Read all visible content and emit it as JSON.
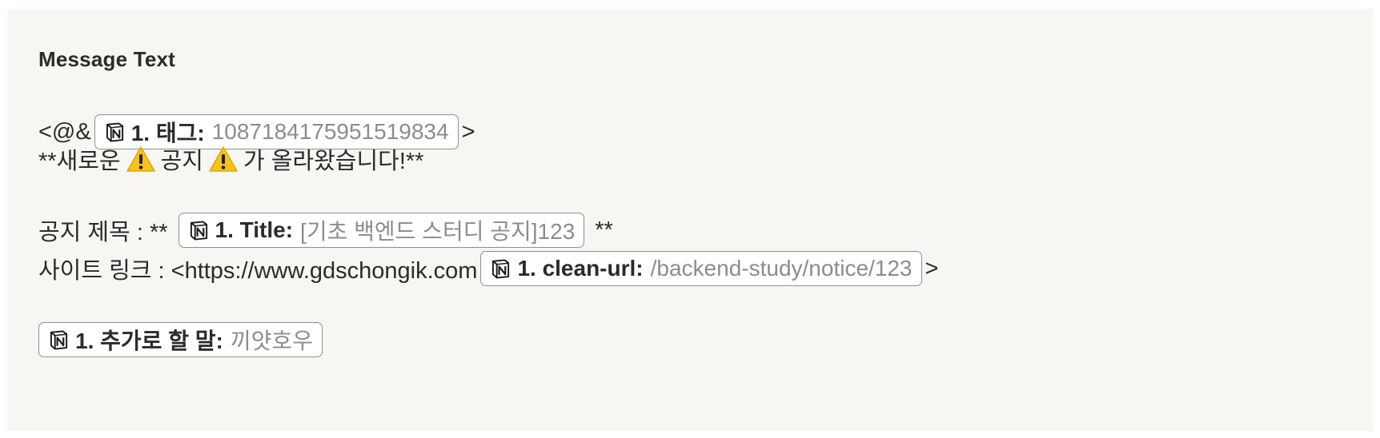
{
  "heading": "Message Text",
  "line1": {
    "prefix": "<@&",
    "pill": {
      "key": "1. 태그:",
      "value": "1087184175951519834"
    },
    "suffix": ">"
  },
  "line2": {
    "text_a": "**새로운",
    "text_b": "공지",
    "text_c": "가 올라왔습니다!**",
    "icon": "warning-icon"
  },
  "line3": {
    "prefix": "공지 제목 : **",
    "pill": {
      "key": "1. Title:",
      "value": "[기초 백엔드 스터디 공지]123"
    },
    "suffix": "**"
  },
  "line4": {
    "prefix": "사이트 링크 : <https://www.gdschongik.com",
    "pill": {
      "key": "1. clean-url:",
      "value": "/backend-study/notice/123"
    },
    "suffix": ">"
  },
  "line5": {
    "pill": {
      "key": "1. 추가로 할 말:",
      "value": "끼얏호우"
    }
  },
  "colors": {
    "panel_bg": "#f7f6f3",
    "pill_border": "#8f8f8f",
    "pill_value": "#8c8c8c",
    "warning": "#f7c31a"
  },
  "icons": {
    "pill_icon": "notion-icon"
  }
}
